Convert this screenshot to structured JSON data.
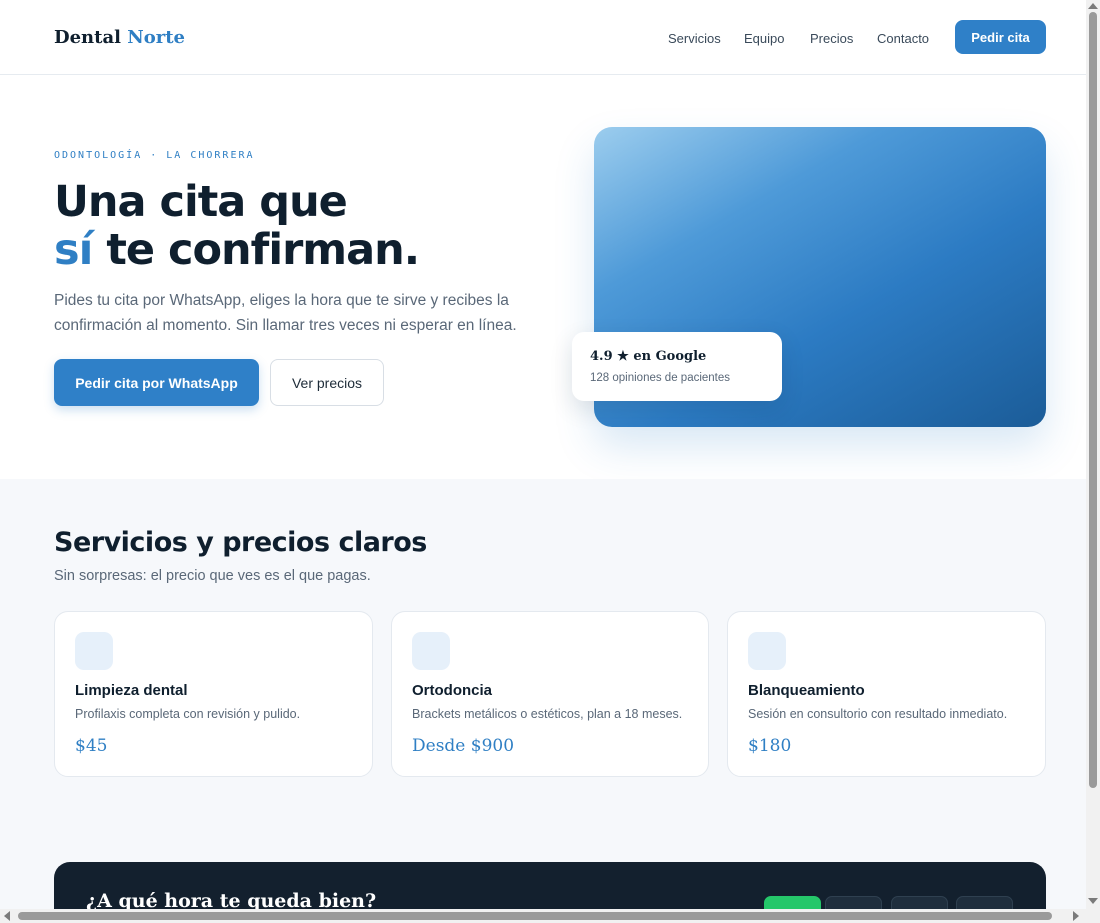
{
  "header": {
    "logo_main": "Dental",
    "logo_accent": "Norte",
    "nav": [
      "Servicios",
      "Equipo",
      "Precios",
      "Contacto"
    ],
    "cta": "Pedir cita"
  },
  "hero": {
    "eyebrow": "ODONTOLOGÍA · LA CHORRERA",
    "title_line1": "Una cita que",
    "title_accent": "sí",
    "title_line2_rest": " te confirman.",
    "lead": "Pides tu cita por WhatsApp, eliges la hora que te sirve y recibes la confirmación al momento. Sin llamar tres veces ni esperar en línea.",
    "primary_button": "Pedir cita por WhatsApp",
    "secondary_button": "Ver precios",
    "rating_title": "4.9 ★ en Google",
    "rating_sub": "128 opiniones de pacientes"
  },
  "services": {
    "title": "Servicios y precios claros",
    "subtitle": "Sin sorpresas: el precio que ves es el que pagas.",
    "cards": [
      {
        "title": "Limpieza dental",
        "desc": "Profilaxis completa con revisión y pulido.",
        "price": "$45"
      },
      {
        "title": "Ortodoncia",
        "desc": "Brackets metálicos o estéticos, plan a 18 meses.",
        "price": "Desde $900"
      },
      {
        "title": "Blanqueamiento",
        "desc": "Sesión en consultorio con resultado inmediato.",
        "price": "$180"
      }
    ]
  },
  "booking": {
    "title": "¿A qué hora te queda bien?"
  },
  "colors": {
    "accent": "#2f7fc4",
    "dark": "#13202e",
    "available": "#25c76a"
  }
}
